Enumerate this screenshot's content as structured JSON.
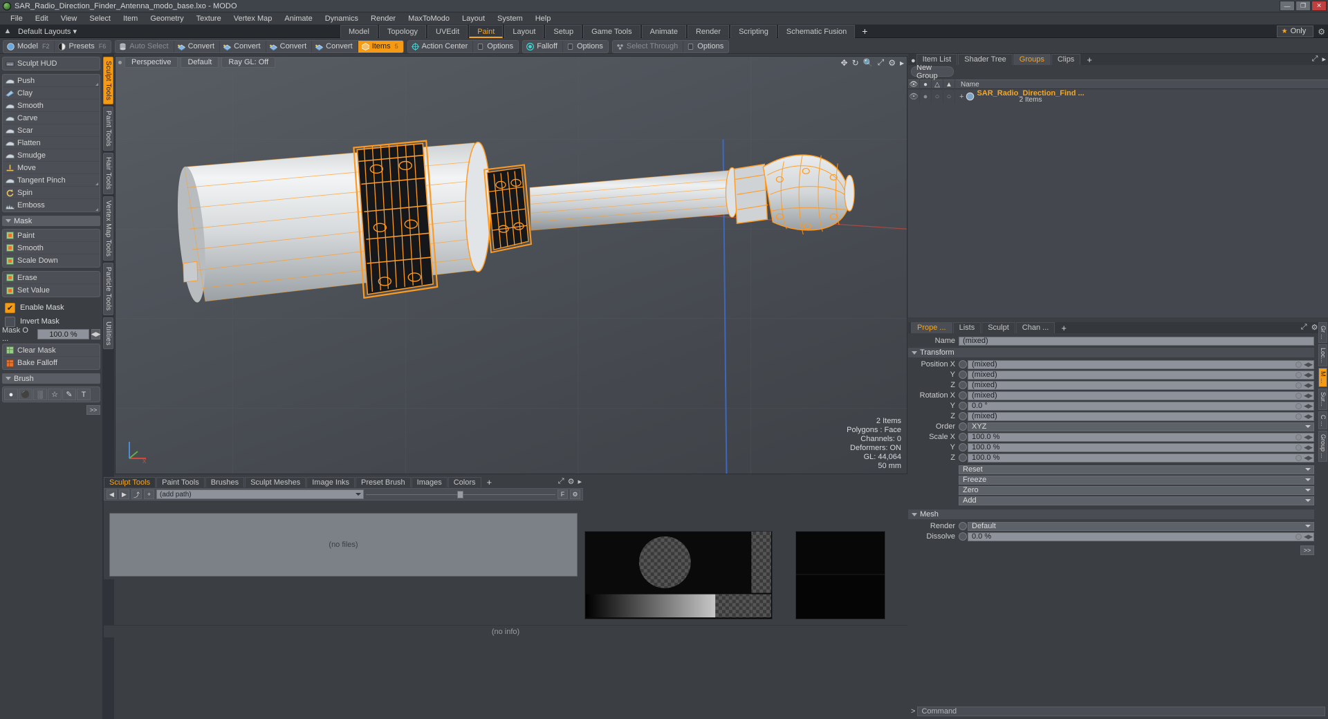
{
  "window": {
    "title": "SAR_Radio_Direction_Finder_Antenna_modo_base.lxo - MODO",
    "app_icon": "modo-sphere-icon",
    "buttons": {
      "minimize": "—",
      "maximize": "❐",
      "close": "✕"
    }
  },
  "menubar": {
    "items": [
      "File",
      "Edit",
      "View",
      "Select",
      "Item",
      "Geometry",
      "Texture",
      "Vertex Map",
      "Animate",
      "Dynamics",
      "Render",
      "MaxToModo",
      "Layout",
      "System",
      "Help"
    ]
  },
  "layoutbar": {
    "home_icon": "home-icon",
    "dropdown_label": "Default Layouts",
    "tabs": [
      {
        "label": "Model",
        "active": false
      },
      {
        "label": "Topology",
        "active": false
      },
      {
        "label": "UVEdit",
        "active": false
      },
      {
        "label": "Paint",
        "active": true
      },
      {
        "label": "Layout",
        "active": false
      },
      {
        "label": "Setup",
        "active": false
      },
      {
        "label": "Game Tools",
        "active": false
      },
      {
        "label": "Animate",
        "active": false
      },
      {
        "label": "Render",
        "active": false
      },
      {
        "label": "Scripting",
        "active": false
      },
      {
        "label": "Schematic Fusion",
        "active": false
      }
    ],
    "add_tab": "+",
    "only_button": "Only",
    "star_icon": "star-icon",
    "gear_icon": "gear-icon"
  },
  "toolbar": {
    "groups": [
      {
        "buttons": [
          {
            "label": "Model",
            "key": "F2",
            "icon": "sphere-icon",
            "state": "normal"
          },
          {
            "label": "Presets",
            "key": "F6",
            "icon": "presets-icon",
            "state": "normal"
          }
        ]
      },
      {
        "buttons": [
          {
            "label": "Auto Select",
            "key": "",
            "icon": "cylinder-icon",
            "state": "dim"
          },
          {
            "label": "Convert",
            "key": "",
            "icon": "convert-vertex-icon",
            "state": "normal"
          },
          {
            "label": "Convert",
            "key": "",
            "icon": "convert-edge-icon",
            "state": "normal"
          },
          {
            "label": "Convert",
            "key": "",
            "icon": "convert-poly-icon",
            "state": "normal"
          },
          {
            "label": "Convert",
            "key": "",
            "icon": "convert-material-icon",
            "state": "normal"
          },
          {
            "label": "Items",
            "key": "5",
            "icon": "items-icon",
            "state": "active"
          }
        ]
      },
      {
        "buttons": [
          {
            "label": "Action Center",
            "key": "",
            "icon": "action-center-icon",
            "state": "normal"
          },
          {
            "label": "Options",
            "key": "",
            "icon": "options-icon",
            "state": "normal"
          }
        ]
      },
      {
        "buttons": [
          {
            "label": "Falloff",
            "key": "",
            "icon": "falloff-icon",
            "state": "normal"
          },
          {
            "label": "Options",
            "key": "",
            "icon": "options-icon",
            "state": "normal"
          }
        ]
      },
      {
        "buttons": [
          {
            "label": "Select Through",
            "key": "",
            "icon": "select-through-icon",
            "state": "dim"
          },
          {
            "label": "Options",
            "key": "",
            "icon": "options-icon",
            "state": "normal"
          }
        ]
      }
    ]
  },
  "left_panel": {
    "hud_button": {
      "label": "Sculpt HUD",
      "icon": "hud-icon"
    },
    "sculpt_tools": [
      {
        "label": "Push",
        "icon": "push-icon",
        "resize": true
      },
      {
        "label": "Clay",
        "icon": "clay-icon",
        "resize": false
      },
      {
        "label": "Smooth",
        "icon": "smooth-icon",
        "resize": false
      },
      {
        "label": "Carve",
        "icon": "carve-icon",
        "resize": false
      },
      {
        "label": "Scar",
        "icon": "scar-icon",
        "resize": false
      },
      {
        "label": "Flatten",
        "icon": "flatten-icon",
        "resize": false
      },
      {
        "label": "Smudge",
        "icon": "smudge-icon",
        "resize": false
      },
      {
        "label": "Move",
        "icon": "move-icon",
        "resize": false
      },
      {
        "label": "Tangent Pinch",
        "icon": "tangent-pinch-icon",
        "resize": true
      },
      {
        "label": "Spin",
        "icon": "spin-icon",
        "resize": false
      },
      {
        "label": "Emboss",
        "icon": "emboss-icon",
        "resize": true
      }
    ],
    "mask_section": {
      "title": "Mask",
      "tools": [
        {
          "label": "Paint",
          "icon": "mask-paint-icon"
        },
        {
          "label": "Smooth",
          "icon": "mask-smooth-icon"
        },
        {
          "label": "Scale Down",
          "icon": "mask-scale-down-icon"
        }
      ],
      "tools2": [
        {
          "label": "Erase",
          "icon": "mask-erase-icon"
        },
        {
          "label": "Set Value",
          "icon": "mask-set-value-icon"
        }
      ],
      "checkboxes": [
        {
          "label": "Enable Mask",
          "checked": true
        },
        {
          "label": "Invert Mask",
          "checked": false
        }
      ],
      "opacity_label": "Mask O ...",
      "opacity_value": "100.0 %",
      "actions": [
        {
          "label": "Clear Mask",
          "icon": "clear-mask-icon"
        },
        {
          "label": "Bake Falloff",
          "icon": "bake-falloff-icon"
        }
      ]
    },
    "brush_section": {
      "title": "Brush",
      "icons": [
        "brush-soft-icon",
        "brush-hard-icon",
        "brush-noise-icon",
        "brush-star-icon",
        "brush-custom-icon",
        "brush-text-icon"
      ],
      "expand_button": ">>"
    }
  },
  "vertical_tabs": [
    {
      "label": "Sculpt Tools",
      "active": true
    },
    {
      "label": "Paint Tools",
      "active": false
    },
    {
      "label": "Hair Tools",
      "active": false
    },
    {
      "label": "Vertex Map Tools",
      "active": false
    },
    {
      "label": "Particle Tools",
      "active": false
    },
    {
      "label": "Utilities",
      "active": false
    }
  ],
  "viewport": {
    "view_label": "Perspective",
    "shading_label": "Default",
    "raygl_label": "Ray GL: Off",
    "header_icons": [
      "move-view-icon",
      "rotate-view-icon",
      "zoom-view-icon",
      "fit-view-icon",
      "viewport-settings-icon",
      "viewport-menu-icon"
    ],
    "stats": [
      "2 Items",
      "Polygons : Face",
      "Channels: 0",
      "Deformers: ON",
      "GL: 44,064",
      "50 mm"
    ],
    "axis_labels": {
      "x": "X",
      "y": "Y",
      "z": "Z"
    }
  },
  "bottom_panel": {
    "tabs": [
      {
        "label": "Sculpt Tools",
        "active": true
      },
      {
        "label": "Paint Tools",
        "active": false
      },
      {
        "label": "Brushes",
        "active": false
      },
      {
        "label": "Sculpt Meshes",
        "active": false
      },
      {
        "label": "Image Inks",
        "active": false
      },
      {
        "label": "Preset Brush",
        "active": false
      },
      {
        "label": "Images",
        "active": false
      },
      {
        "label": "Colors",
        "active": false
      }
    ],
    "add_tab": "+",
    "panel_icons": [
      "popout-icon",
      "settings-icon",
      "menu-icon"
    ],
    "nav": {
      "back": "◀",
      "forward": "▶",
      "up": "⤴",
      "add": "+"
    },
    "path_placeholder": "(add path)",
    "filter_button": "F",
    "filter_gear": "gear-icon",
    "empty_message": "(no files)",
    "status": "(no info)"
  },
  "right_panel": {
    "top_tabs": [
      {
        "label": "Item List",
        "active": false
      },
      {
        "label": "Shader Tree",
        "active": false
      },
      {
        "label": "Groups",
        "active": true
      },
      {
        "label": "Clips",
        "active": false
      }
    ],
    "top_add": "+",
    "top_icons": [
      "popout-icon",
      "expand-icon"
    ],
    "new_group_button": "New Group",
    "tree_columns": [
      "visible-eye-icon",
      "render-camera-icon",
      "wireframe-icon",
      "shading-icon",
      "Name"
    ],
    "tree_rows": [
      {
        "expander": "+",
        "icon": "group-icon",
        "name": "SAR_Radio_Direction_Find ...",
        "sub": "2 Items"
      }
    ],
    "prop_tabs": [
      {
        "label": "Prope ...",
        "active": true
      },
      {
        "label": "Lists",
        "active": false
      },
      {
        "label": "Sculpt",
        "active": false
      },
      {
        "label": "Chan ...",
        "active": false
      }
    ],
    "prop_add": "+",
    "prop_icons": [
      "popout-icon",
      "gear-icon",
      "menu-icon"
    ],
    "name_label": "Name",
    "name_value": "(mixed)",
    "transform_title": "Transform",
    "transform_rows": [
      {
        "label": "Position X",
        "value": "(mixed)"
      },
      {
        "label": "Y",
        "value": "(mixed)"
      },
      {
        "label": "Z",
        "value": "(mixed)"
      },
      {
        "label": "Rotation X",
        "value": "(mixed)"
      },
      {
        "label": "Y",
        "value": "0.0 °"
      },
      {
        "label": "Z",
        "value": "(mixed)"
      },
      {
        "label": "Order",
        "value": "XYZ",
        "dropdown": true
      },
      {
        "label": "Scale X",
        "value": "100.0 %"
      },
      {
        "label": "Y",
        "value": "100.0 %"
      },
      {
        "label": "Z",
        "value": "100.0 %"
      }
    ],
    "action_dropdowns": [
      "Reset",
      "Freeze",
      "Zero",
      "Add"
    ],
    "mesh_title": "Mesh",
    "mesh_rows": [
      {
        "label": "Render",
        "value": "Default",
        "dropdown": true
      },
      {
        "label": "Dissolve",
        "value": "0.0 %",
        "dropdown": false
      }
    ],
    "side_tabs": [
      {
        "label": "Gr ...",
        "active": false
      },
      {
        "label": "Loc...",
        "active": false
      },
      {
        "label": "M ...",
        "active": true
      },
      {
        "label": "Sur...",
        "active": false
      },
      {
        "label": "C ...",
        "active": false
      },
      {
        "label": "Group ...",
        "active": false
      }
    ],
    "expand_button": ">>",
    "command_prompt": ">",
    "command_placeholder": "Command"
  },
  "colors": {
    "accent": "#f5a623",
    "wireframe": "#ff9a20",
    "panel_bg": "#3b3f44",
    "field_bg": "#8e939b",
    "viewport_bg": "#4e535a"
  }
}
